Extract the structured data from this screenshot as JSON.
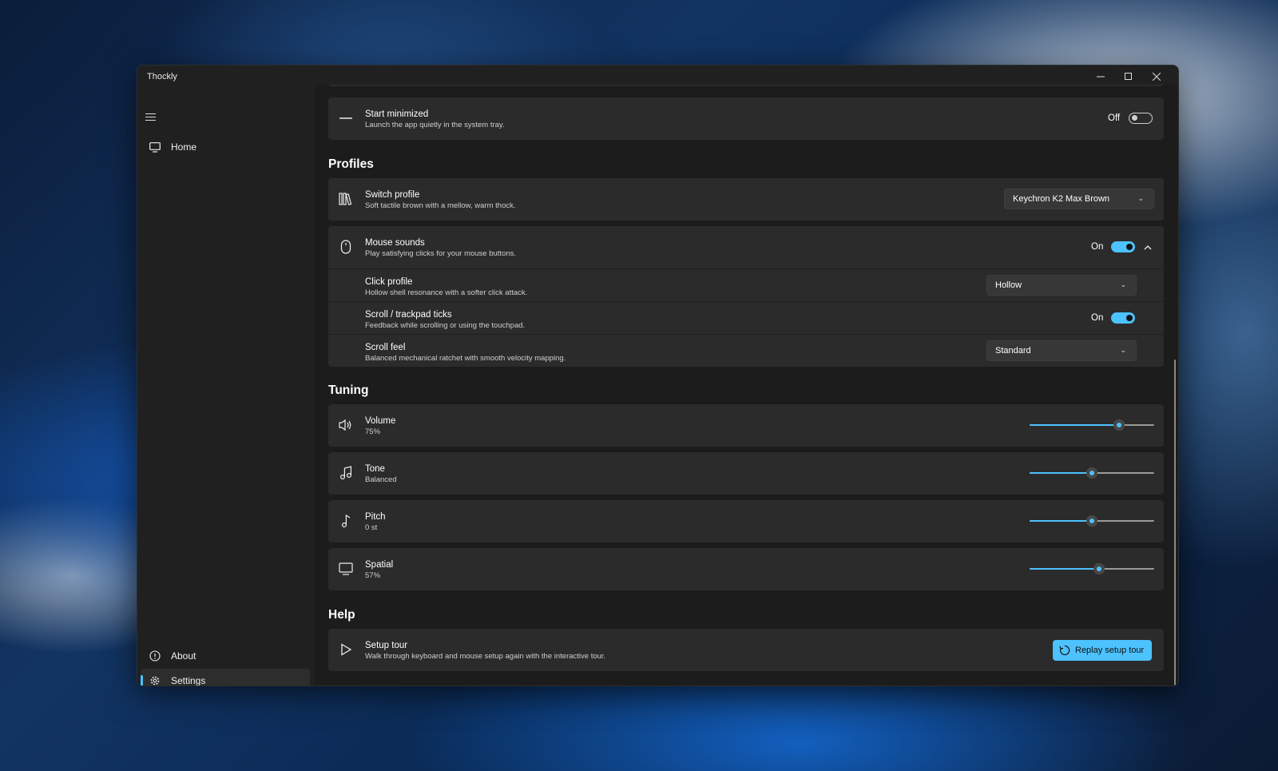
{
  "window": {
    "title": "Thockly"
  },
  "sidebar": {
    "items": [
      {
        "label": "Home",
        "icon": "monitor-icon"
      },
      {
        "label": "About",
        "icon": "info-icon"
      },
      {
        "label": "Settings",
        "icon": "gear-icon",
        "active": true
      }
    ]
  },
  "general": {
    "start_minimized": {
      "title": "Start minimized",
      "desc": "Launch the app quietly in the system tray.",
      "state_label": "Off",
      "on": false
    }
  },
  "profiles": {
    "section_title": "Profiles",
    "switch_profile": {
      "title": "Switch profile",
      "desc": "Soft tactile brown with a mellow, warm thock.",
      "value": "Keychron K2 Max Brown"
    },
    "mouse_sounds": {
      "title": "Mouse sounds",
      "desc": "Play satisfying clicks for your mouse buttons.",
      "state_label": "On",
      "on": true
    },
    "click_profile": {
      "title": "Click profile",
      "desc": "Hollow shell resonance with a softer click attack.",
      "value": "Hollow"
    },
    "scroll_ticks": {
      "title": "Scroll / trackpad ticks",
      "desc": "Feedback while scrolling or using the touchpad.",
      "state_label": "On",
      "on": true
    },
    "scroll_feel": {
      "title": "Scroll feel",
      "desc": "Balanced mechanical ratchet with smooth velocity mapping.",
      "value": "Standard"
    }
  },
  "tuning": {
    "section_title": "Tuning",
    "volume": {
      "title": "Volume",
      "value_text": "75%",
      "level": 0.72
    },
    "tone": {
      "title": "Tone",
      "value_text": "Balanced",
      "level": 0.5
    },
    "pitch": {
      "title": "Pitch",
      "value_text": "0 st",
      "level": 0.5
    },
    "spatial": {
      "title": "Spatial",
      "value_text": "57%",
      "level": 0.56
    }
  },
  "help": {
    "section_title": "Help",
    "setup_tour": {
      "title": "Setup tour",
      "desc": "Walk through keyboard and mouse setup again with the interactive tour.",
      "button_label": "Replay setup tour"
    }
  },
  "colors": {
    "accent": "#4cc2ff",
    "card": "#2b2b2b",
    "window": "#202020"
  }
}
